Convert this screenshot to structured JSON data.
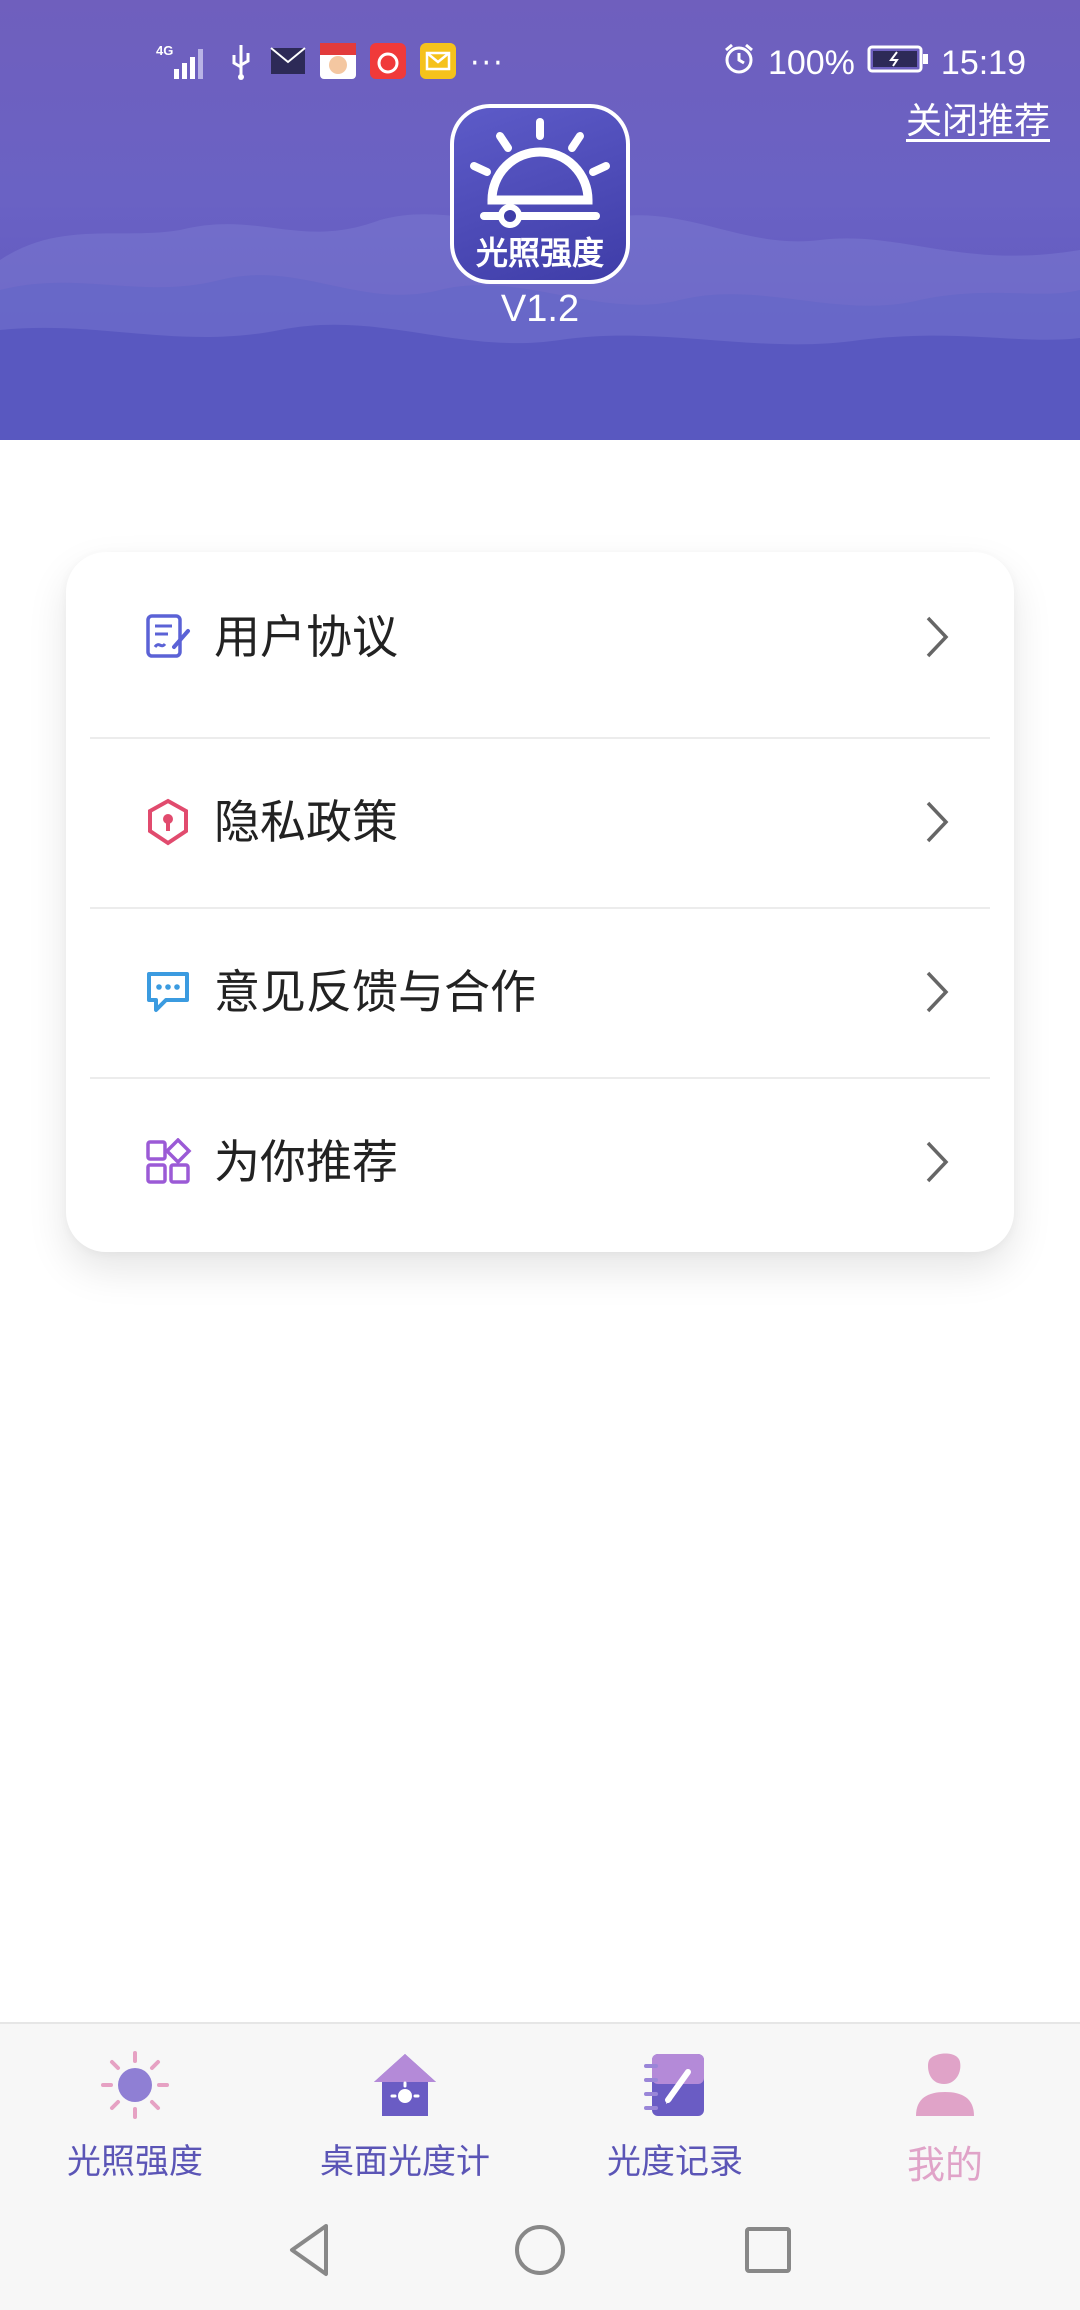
{
  "status_bar": {
    "network": "4G",
    "battery_percent": "100%",
    "time": "15:19",
    "more": "···",
    "icons": [
      "signal-icon",
      "usb-icon",
      "mail-icon",
      "app-notification-icon",
      "app-notification-icon",
      "email-icon",
      "alarm-icon",
      "battery-icon"
    ]
  },
  "header": {
    "close_recommend": "关闭推荐",
    "app_logo_text": "光照强度",
    "version": "V1.2"
  },
  "menu": {
    "items": [
      {
        "label": "用户协议",
        "icon": "agreement-icon",
        "color": "#5b62d6"
      },
      {
        "label": "隐私政策",
        "icon": "shield-icon",
        "color": "#e14b6e"
      },
      {
        "label": "意见反馈与合作",
        "icon": "chat-icon",
        "color": "#3b9be0"
      },
      {
        "label": "为你推荐",
        "icon": "apps-icon",
        "color": "#9b5ad6"
      }
    ]
  },
  "bottom_nav": {
    "items": [
      {
        "label": "光照强度",
        "icon": "sun-icon",
        "active": false
      },
      {
        "label": "桌面光度计",
        "icon": "house-light-icon",
        "active": false
      },
      {
        "label": "光度记录",
        "icon": "notebook-icon",
        "active": false
      },
      {
        "label": "我的",
        "icon": "user-icon",
        "active": true
      }
    ]
  },
  "colors": {
    "header_top": "#6f5fbd",
    "header_bottom": "#5a52bd",
    "nav_inactive": "#5b55b6",
    "nav_active": "#e0a3c8"
  }
}
